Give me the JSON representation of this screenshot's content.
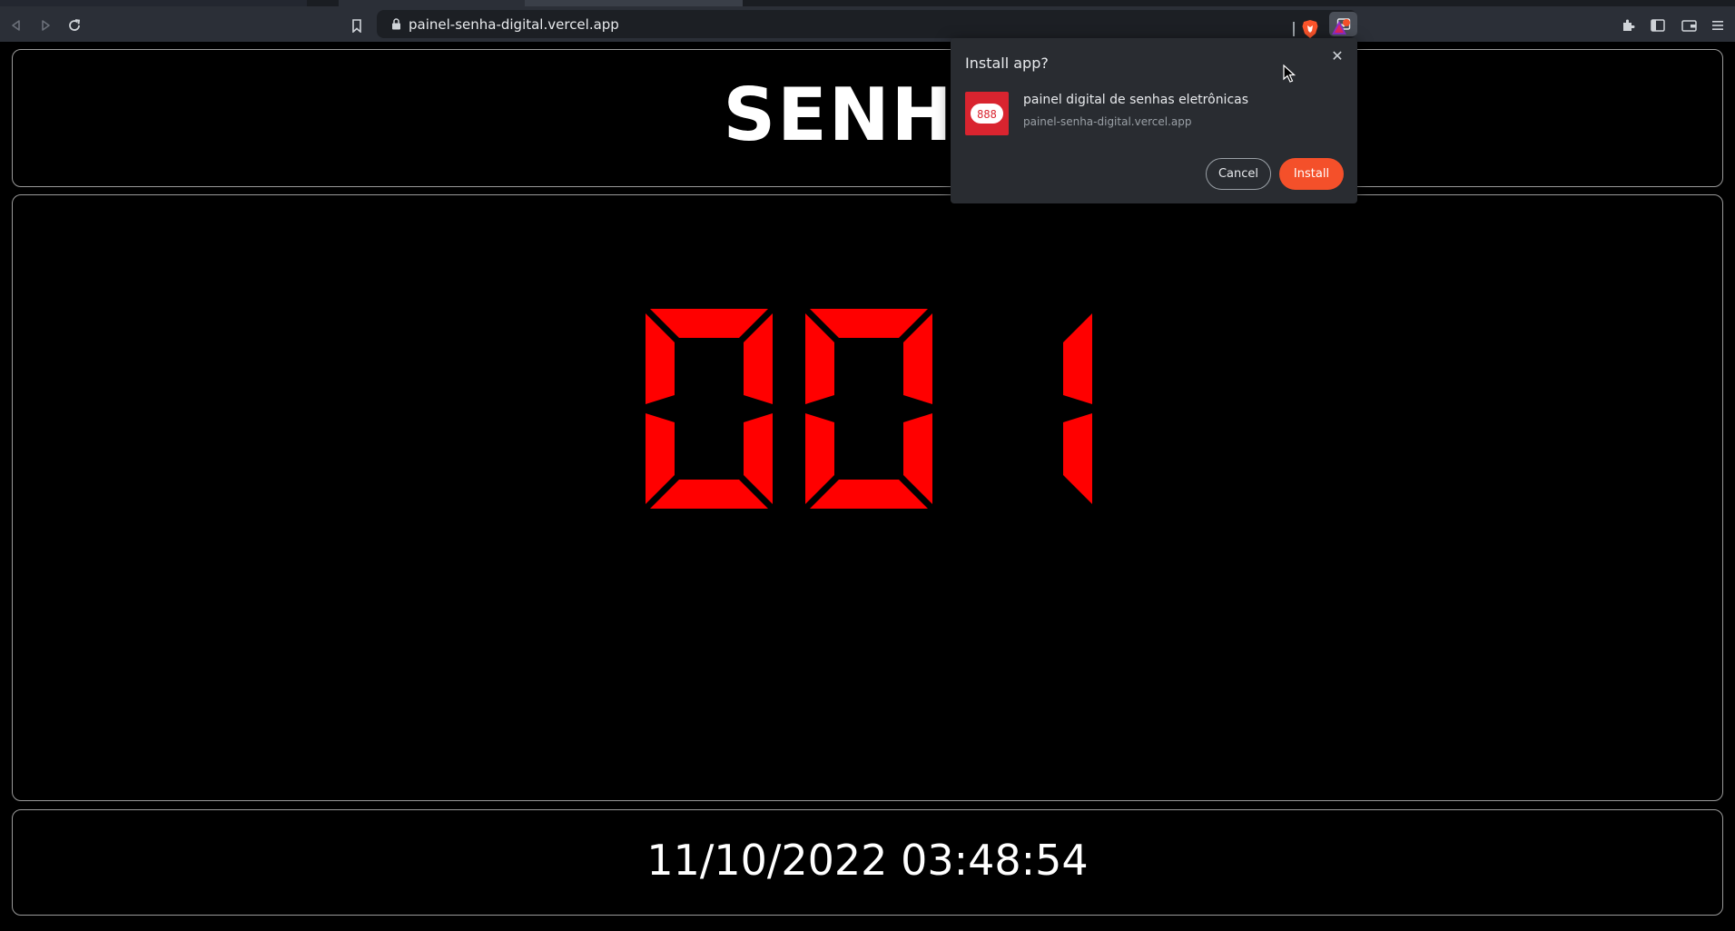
{
  "browser": {
    "url": "painel-senha-digital.vercel.app",
    "icons": [
      "back-icon",
      "forward-icon",
      "reload-icon",
      "bookmark-icon",
      "lock-icon",
      "install-app-icon",
      "brave-shields-icon",
      "brave-rewards-icon",
      "extensions-icon",
      "sidebar-icon",
      "wallet-icon",
      "menu-icon"
    ]
  },
  "page": {
    "title": "SENHA",
    "number": "001",
    "datetime": "11/10/2022 03:48:54",
    "digit_color": "#ff0000",
    "background": "#000000"
  },
  "install_dialog": {
    "title": "Install app?",
    "app_name": "painel digital de senhas eletrônicas",
    "app_url": "painel-senha-digital.vercel.app",
    "app_icon_text": "888",
    "cancel_label": "Cancel",
    "install_label": "Install",
    "install_color": "#f4502a"
  }
}
